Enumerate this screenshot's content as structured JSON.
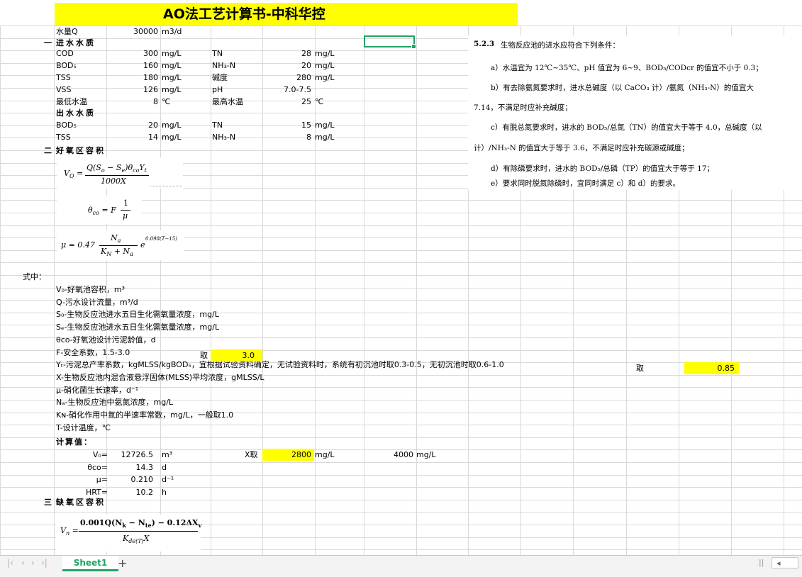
{
  "title": "AO法工艺计算书-中科华控",
  "flow": {
    "label": "水量Q",
    "value": "30000",
    "unit": "m3/d"
  },
  "sec1": {
    "label": "一",
    "name": "进水水质"
  },
  "inlet": [
    [
      "COD",
      "300",
      "mg/L",
      "TN",
      "28",
      "mg/L"
    ],
    [
      "BOD₅",
      "160",
      "mg/L",
      "NH₃-N",
      "20",
      "mg/L"
    ],
    [
      "TSS",
      "180",
      "mg/L",
      "碱度",
      "280",
      "mg/L"
    ],
    [
      "VSS",
      "126",
      "mg/L",
      "pH",
      "7.0-7.5",
      ""
    ],
    [
      "最低水温",
      "8",
      "℃",
      "最高水温",
      "25",
      "℃"
    ]
  ],
  "outlet_title": "出水水质",
  "outlet": [
    [
      "BOD₅",
      "20",
      "mg/L",
      "TN",
      "15",
      "mg/L"
    ],
    [
      "TSS",
      "14",
      "mg/L",
      "NH₃-N",
      "8",
      "mg/L"
    ]
  ],
  "sec2": {
    "label": "二",
    "name": "好氧区容积"
  },
  "formulas": {
    "f1_left": "V",
    "f1_sub": "O",
    "f1_num": "Q(S",
    "f1_num2": "o",
    "f1_num3": " − S",
    "f1_num4": "e",
    "f1_num5": ")θ",
    "f1_num6": "co",
    "f1_num7": "Y",
    "f1_num8": "t",
    "f1_den": "1000X",
    "f2_left": "θ",
    "f2_sub": "co",
    "f2_mid": "= F",
    "f2_num": "1",
    "f2_den": "μ",
    "f3_left": "μ = 0.47",
    "f3_num": "N",
    "f3_numsub": "a",
    "f3_den": "K",
    "f3_densub": "N",
    "f3_den2": " + N",
    "f3_den2sub": "a",
    "f3_exp": "e",
    "f3_pow": "0.098(T−15)",
    "f4_left": "V",
    "f4_sub": "n",
    "f4_num": "0.001Q(N",
    "f4_n1": "k",
    "f4_n2": " − N",
    "f4_n3": "te",
    "f4_n4": ") − 0.12ΔX",
    "f4_n5": "v",
    "f4_den": "K",
    "f4_densub": "de(T)",
    "f4_den2": "X"
  },
  "shizhong": "式中：",
  "defs": [
    "V₀-好氧池容积，m³",
    "Q-污水设计流量，m³/d",
    "S₀-生物反应池进水五日生化需氧量浓度，mg/L",
    "Sₑ-生物反应池进水五日生化需氧量浓度，mg/L",
    "θco-好氧池设计污泥龄值，d",
    "F-安全系数，1.5-3.0",
    "Yₜ-污泥总产率系数，kgMLSS/kgBOD₅，宜根据试验资料确定，无试验资料时，系统有初沉池时取0.3-0.5，无初沉池时取0.6-1.0",
    "X-生物反应池内混合液悬浮固体(MLSS)平均浓度，gMLSS/L",
    "μ-硝化菌生长速率，d⁻¹",
    "Nₐ-生物反应池中氨氮浓度，mg/L",
    "Kɴ-硝化作用中氮的半速率常数，mg/L，一般取1.0",
    "T-设计温度，℃"
  ],
  "f_take": {
    "label": "取",
    "value": "3.0"
  },
  "y_take": {
    "label": "取",
    "value": "0.85"
  },
  "calc_title": "计算值：",
  "calc": [
    {
      "label": "V₀=",
      "value": "12726.5",
      "unit": "m³"
    },
    {
      "label": "θco=",
      "value": "14.3",
      "unit": "d"
    },
    {
      "label": "μ=",
      "value": "0.210",
      "unit": "d⁻¹"
    },
    {
      "label": "HRT=",
      "value": "10.2",
      "unit": "h"
    }
  ],
  "x_take": {
    "label": "X取",
    "value": "2800",
    "unit": "mg/L",
    "value2": "4000",
    "unit2": "mg/L"
  },
  "sec3": {
    "label": "三",
    "name": "缺氧区容积"
  },
  "note": {
    "heading_num": "5.2.3",
    "heading": "生物反应池的进水应符合下列条件：",
    "a": "a）水温宜为 12℃~35℃、pH 值宜为 6~9、BOD₅/CODcr 的值宜不小于 0.3；",
    "b1": "b）有去除氨氮要求时，进水总碱度（以 CaCO₃ 计）/氨氮（NH₃-N）的值宜大",
    "b2": "7.14，不满足时应补充碱度；",
    "c1": "c）有脱总氮要求时，进水的 BOD₅/总氮（TN）的值宜大于等于 4.0，总碱度（以",
    "c2": "计）/NH₃-N 的值宜大于等于 3.6，不满足时应补充碳源或碱度；",
    "d": "d）有除磷要求时，进水的 BOD₅/总磷（TP）的值宜大于等于 17；",
    "e": "e）要求同时脱氮除磷时，宜同时满足 c）和 d）的要求。"
  },
  "tabbar": {
    "sheet": "Sheet1",
    "add": "+"
  },
  "colors": {
    "highlight": "#ffff00",
    "accent": "#21a366",
    "grid": "#d9d9d9"
  }
}
